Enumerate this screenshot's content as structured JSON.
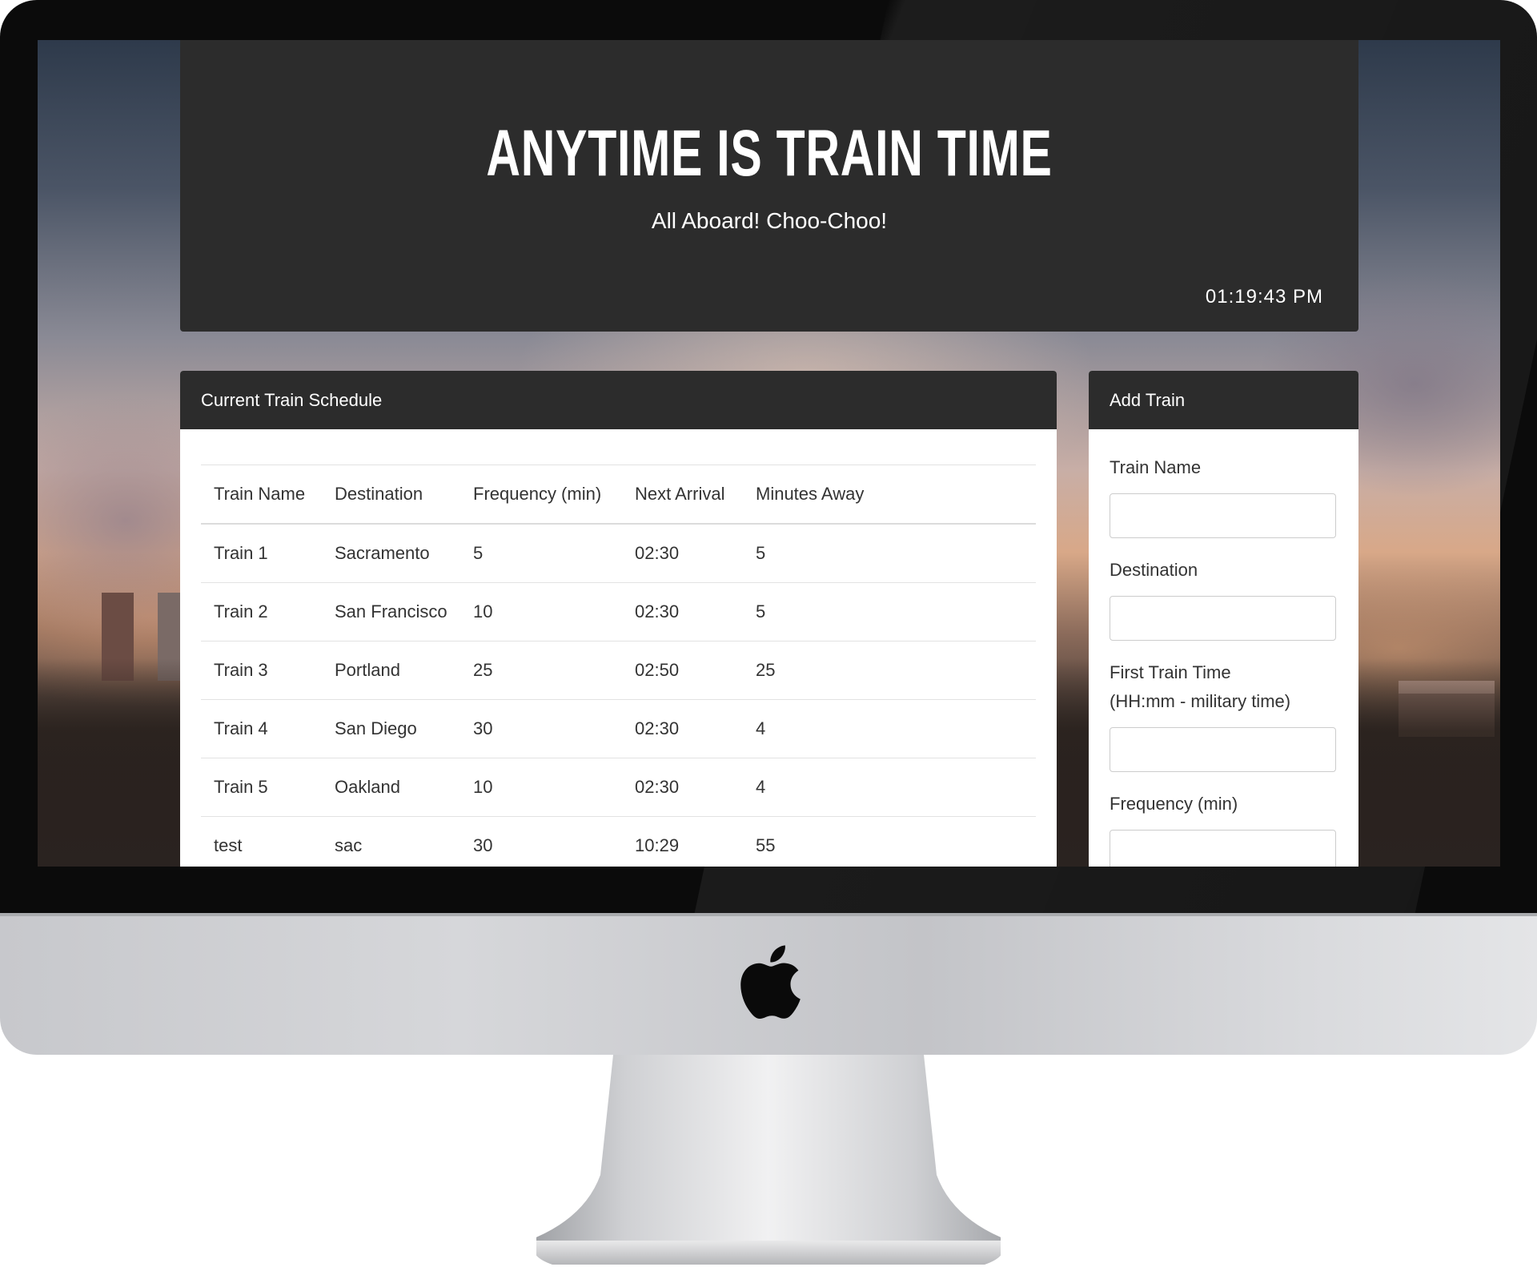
{
  "header": {
    "title": "ANYTIME IS TRAIN TIME",
    "subtitle": "All Aboard! Choo-Choo!",
    "clock": "01:19:43 PM"
  },
  "schedule": {
    "heading": "Current Train Schedule",
    "columns": [
      "Train Name",
      "Destination",
      "Frequency (min)",
      "Next Arrival",
      "Minutes Away"
    ],
    "rows": [
      [
        "Train 1",
        "Sacramento",
        "5",
        "02:30",
        "5"
      ],
      [
        "Train 2",
        "San Francisco",
        "10",
        "02:30",
        "5"
      ],
      [
        "Train 3",
        "Portland",
        "25",
        "02:50",
        "25"
      ],
      [
        "Train 4",
        "San Diego",
        "30",
        "02:30",
        "4"
      ],
      [
        "Train 5",
        "Oakland",
        "10",
        "02:30",
        "4"
      ],
      [
        "test",
        "sac",
        "30",
        "10:29",
        "55"
      ]
    ]
  },
  "add_train": {
    "heading": "Add Train",
    "fields": {
      "train_name": {
        "label": "Train Name",
        "value": ""
      },
      "destination": {
        "label": "Destination",
        "value": ""
      },
      "first_train_time": {
        "label": "First Train Time",
        "label_line2": "(HH:mm - military time)",
        "value": ""
      },
      "frequency": {
        "label": "Frequency (min)",
        "value": ""
      }
    }
  },
  "device": {
    "logo_icon": "apple-logo-icon"
  },
  "colors": {
    "panel_dark": "#2c2c2c",
    "text": "#333333",
    "white": "#ffffff"
  }
}
